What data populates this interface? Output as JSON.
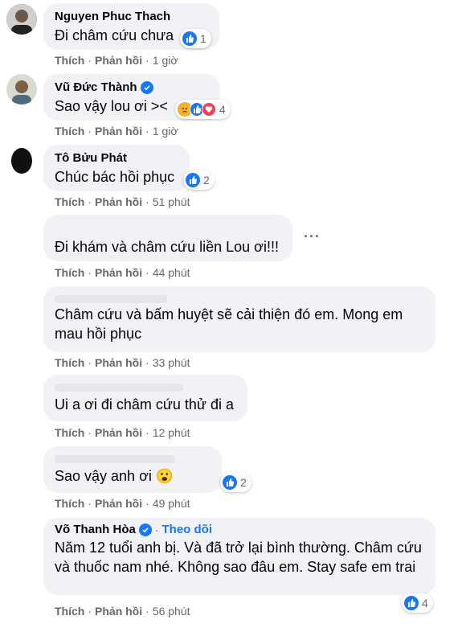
{
  "actions": {
    "like": "Thích",
    "reply": "Phản hồi",
    "separator": "·"
  },
  "comments": [
    {
      "author": "Nguyen Phuc Thach",
      "text": "Đi châm cứu chưa",
      "reaction_count": "1",
      "time": "1 giờ"
    },
    {
      "author": "Vũ Đức Thành",
      "text": "Sao vậy lou ơi ><",
      "reaction_count": "4",
      "time": "1 giờ"
    },
    {
      "author": "Tô Bửu Phát",
      "text": "Chúc bác hồi phục",
      "reaction_count": "2",
      "time": "51 phút"
    },
    {
      "author": "",
      "text": "Đi khám và châm cứu liền Lou ơi!!!",
      "time": "44 phút",
      "more": "···"
    },
    {
      "author": "",
      "text": "Châm cứu và bấm huyệt sẽ cải thiện đó em. Mong em mau hồi phục",
      "time": "33 phút"
    },
    {
      "author": "",
      "text": "Ui a ơi đi châm cứu thử đi a",
      "time": "12 phút"
    },
    {
      "author": "",
      "text": "Sao vậy anh ơi 😮",
      "reaction_count": "2",
      "time": "49 phút"
    },
    {
      "author": "Võ Thanh Hòa",
      "follow": "Theo dõi",
      "text": "Năm 12 tuổi anh bị. Và đã trở lại bình thường. Châm cứu và thuốc nam nhé. Không sao đâu em. Stay safe em trai",
      "reaction_count": "4",
      "time": "56 phút"
    }
  ],
  "colors": {
    "like_blue": "#1877f2",
    "bubble": "#f0f2f5",
    "meta": "#65676b"
  }
}
